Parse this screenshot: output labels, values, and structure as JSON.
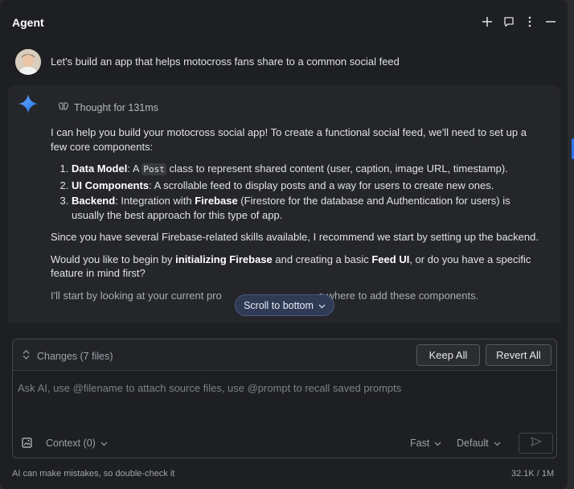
{
  "header": {
    "title": "Agent",
    "icons": [
      "plus-icon",
      "chat-bubble-icon",
      "more-vertical-icon",
      "minimize-icon"
    ]
  },
  "user_message": {
    "text": "Let's build an app that helps motocross fans share to a common social feed"
  },
  "response": {
    "thought": "Thought for 131ms",
    "intro": "I can help you build your motocross social app! To create a functional social feed, we'll need to set up a few core components:",
    "list": [
      {
        "label": "Data Model",
        "pre": ": A ",
        "code": "Post",
        "post": " class to represent shared content (user, caption, image URL, timestamp)."
      },
      {
        "label": "UI Components",
        "post": ": A scrollable feed to display posts and a way for users to create new ones."
      },
      {
        "label": "Backend",
        "mid": ": Integration with ",
        "bold2": "Firebase",
        "post": " (Firestore for the database and Authentication for users) is usually the best approach for this type of app."
      }
    ],
    "p2": "Since you have several Firebase-related skills available, I recommend we start by setting up the backend.",
    "p3": {
      "a": "Would you like to begin by ",
      "b": "initializing Firebase",
      "c": " and creating a basic ",
      "d": "Feed UI",
      "e": ", or do you have a specific feature in mind first?"
    },
    "p4": {
      "a": "I'll start by looking at your current pro",
      "b": "e where to add these components."
    }
  },
  "scroll_button": {
    "label": "Scroll to bottom"
  },
  "changes": {
    "label": "Changes (7 files)",
    "keep_all": "Keep All",
    "revert_all": "Revert All"
  },
  "composer": {
    "placeholder": "Ask AI, use @filename to attach source files, use @prompt to recall saved prompts",
    "context": "Context (0)",
    "mode": "Fast",
    "model": "Default"
  },
  "footer": {
    "disclaimer": "AI can make mistakes, so double-check it",
    "tokens": "32.1K / 1M"
  },
  "colors": {
    "accent": "#3574f0",
    "background": "#1e1f22",
    "gemini_gradient": [
      "#4f8cff",
      "#1a73e8"
    ]
  }
}
